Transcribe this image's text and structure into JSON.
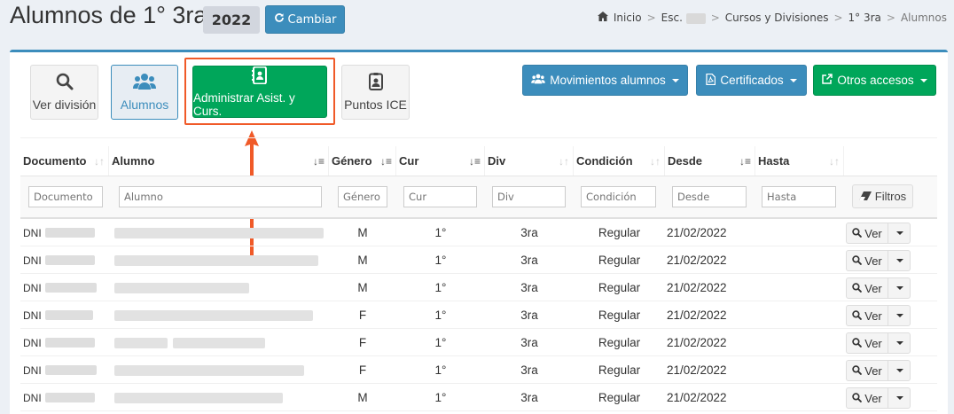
{
  "header": {
    "title": "Alumnos de 1° 3ra -",
    "year": "2022",
    "change_button": "Cambiar"
  },
  "breadcrumb": {
    "home": "Inicio",
    "school_prefix": "Esc.",
    "courses": "Cursos y Divisiones",
    "division": "1° 3ra",
    "current": "Alumnos"
  },
  "toolbar": {
    "ver_division": "Ver división",
    "alumnos": "Alumnos",
    "administrar": "Administrar Asist. y Curs.",
    "puntos_ice": "Puntos ICE",
    "movimientos": "Movimientos alumnos",
    "certificados": "Certificados",
    "otros": "Otros accesos"
  },
  "table": {
    "columns": [
      "Documento",
      "Alumno",
      "Género",
      "Cur",
      "Div",
      "Condición",
      "Desde",
      "Hasta"
    ],
    "filters": [
      "Documento",
      "Alumno",
      "Género",
      "Cur",
      "Div",
      "Condición",
      "Desde",
      "Hasta"
    ],
    "filter_button": "Filtros",
    "view_button": "Ver",
    "doc_prefix": "DNI",
    "rows": [
      {
        "genero": "M",
        "cur": "1°",
        "div": "3ra",
        "condicion": "Regular",
        "desde": "21/02/2022",
        "hasta": ""
      },
      {
        "genero": "M",
        "cur": "1°",
        "div": "3ra",
        "condicion": "Regular",
        "desde": "21/02/2022",
        "hasta": ""
      },
      {
        "genero": "M",
        "cur": "1°",
        "div": "3ra",
        "condicion": "Regular",
        "desde": "21/02/2022",
        "hasta": ""
      },
      {
        "genero": "F",
        "cur": "1°",
        "div": "3ra",
        "condicion": "Regular",
        "desde": "21/02/2022",
        "hasta": ""
      },
      {
        "genero": "F",
        "cur": "1°",
        "div": "3ra",
        "condicion": "Regular",
        "desde": "21/02/2022",
        "hasta": ""
      },
      {
        "genero": "F",
        "cur": "1°",
        "div": "3ra",
        "condicion": "Regular",
        "desde": "21/02/2022",
        "hasta": ""
      },
      {
        "genero": "M",
        "cur": "1°",
        "div": "3ra",
        "condicion": "Regular",
        "desde": "21/02/2022",
        "hasta": ""
      }
    ]
  },
  "colors": {
    "primary": "#3c8dbc",
    "success": "#00a65a",
    "highlight": "#f05a28"
  }
}
